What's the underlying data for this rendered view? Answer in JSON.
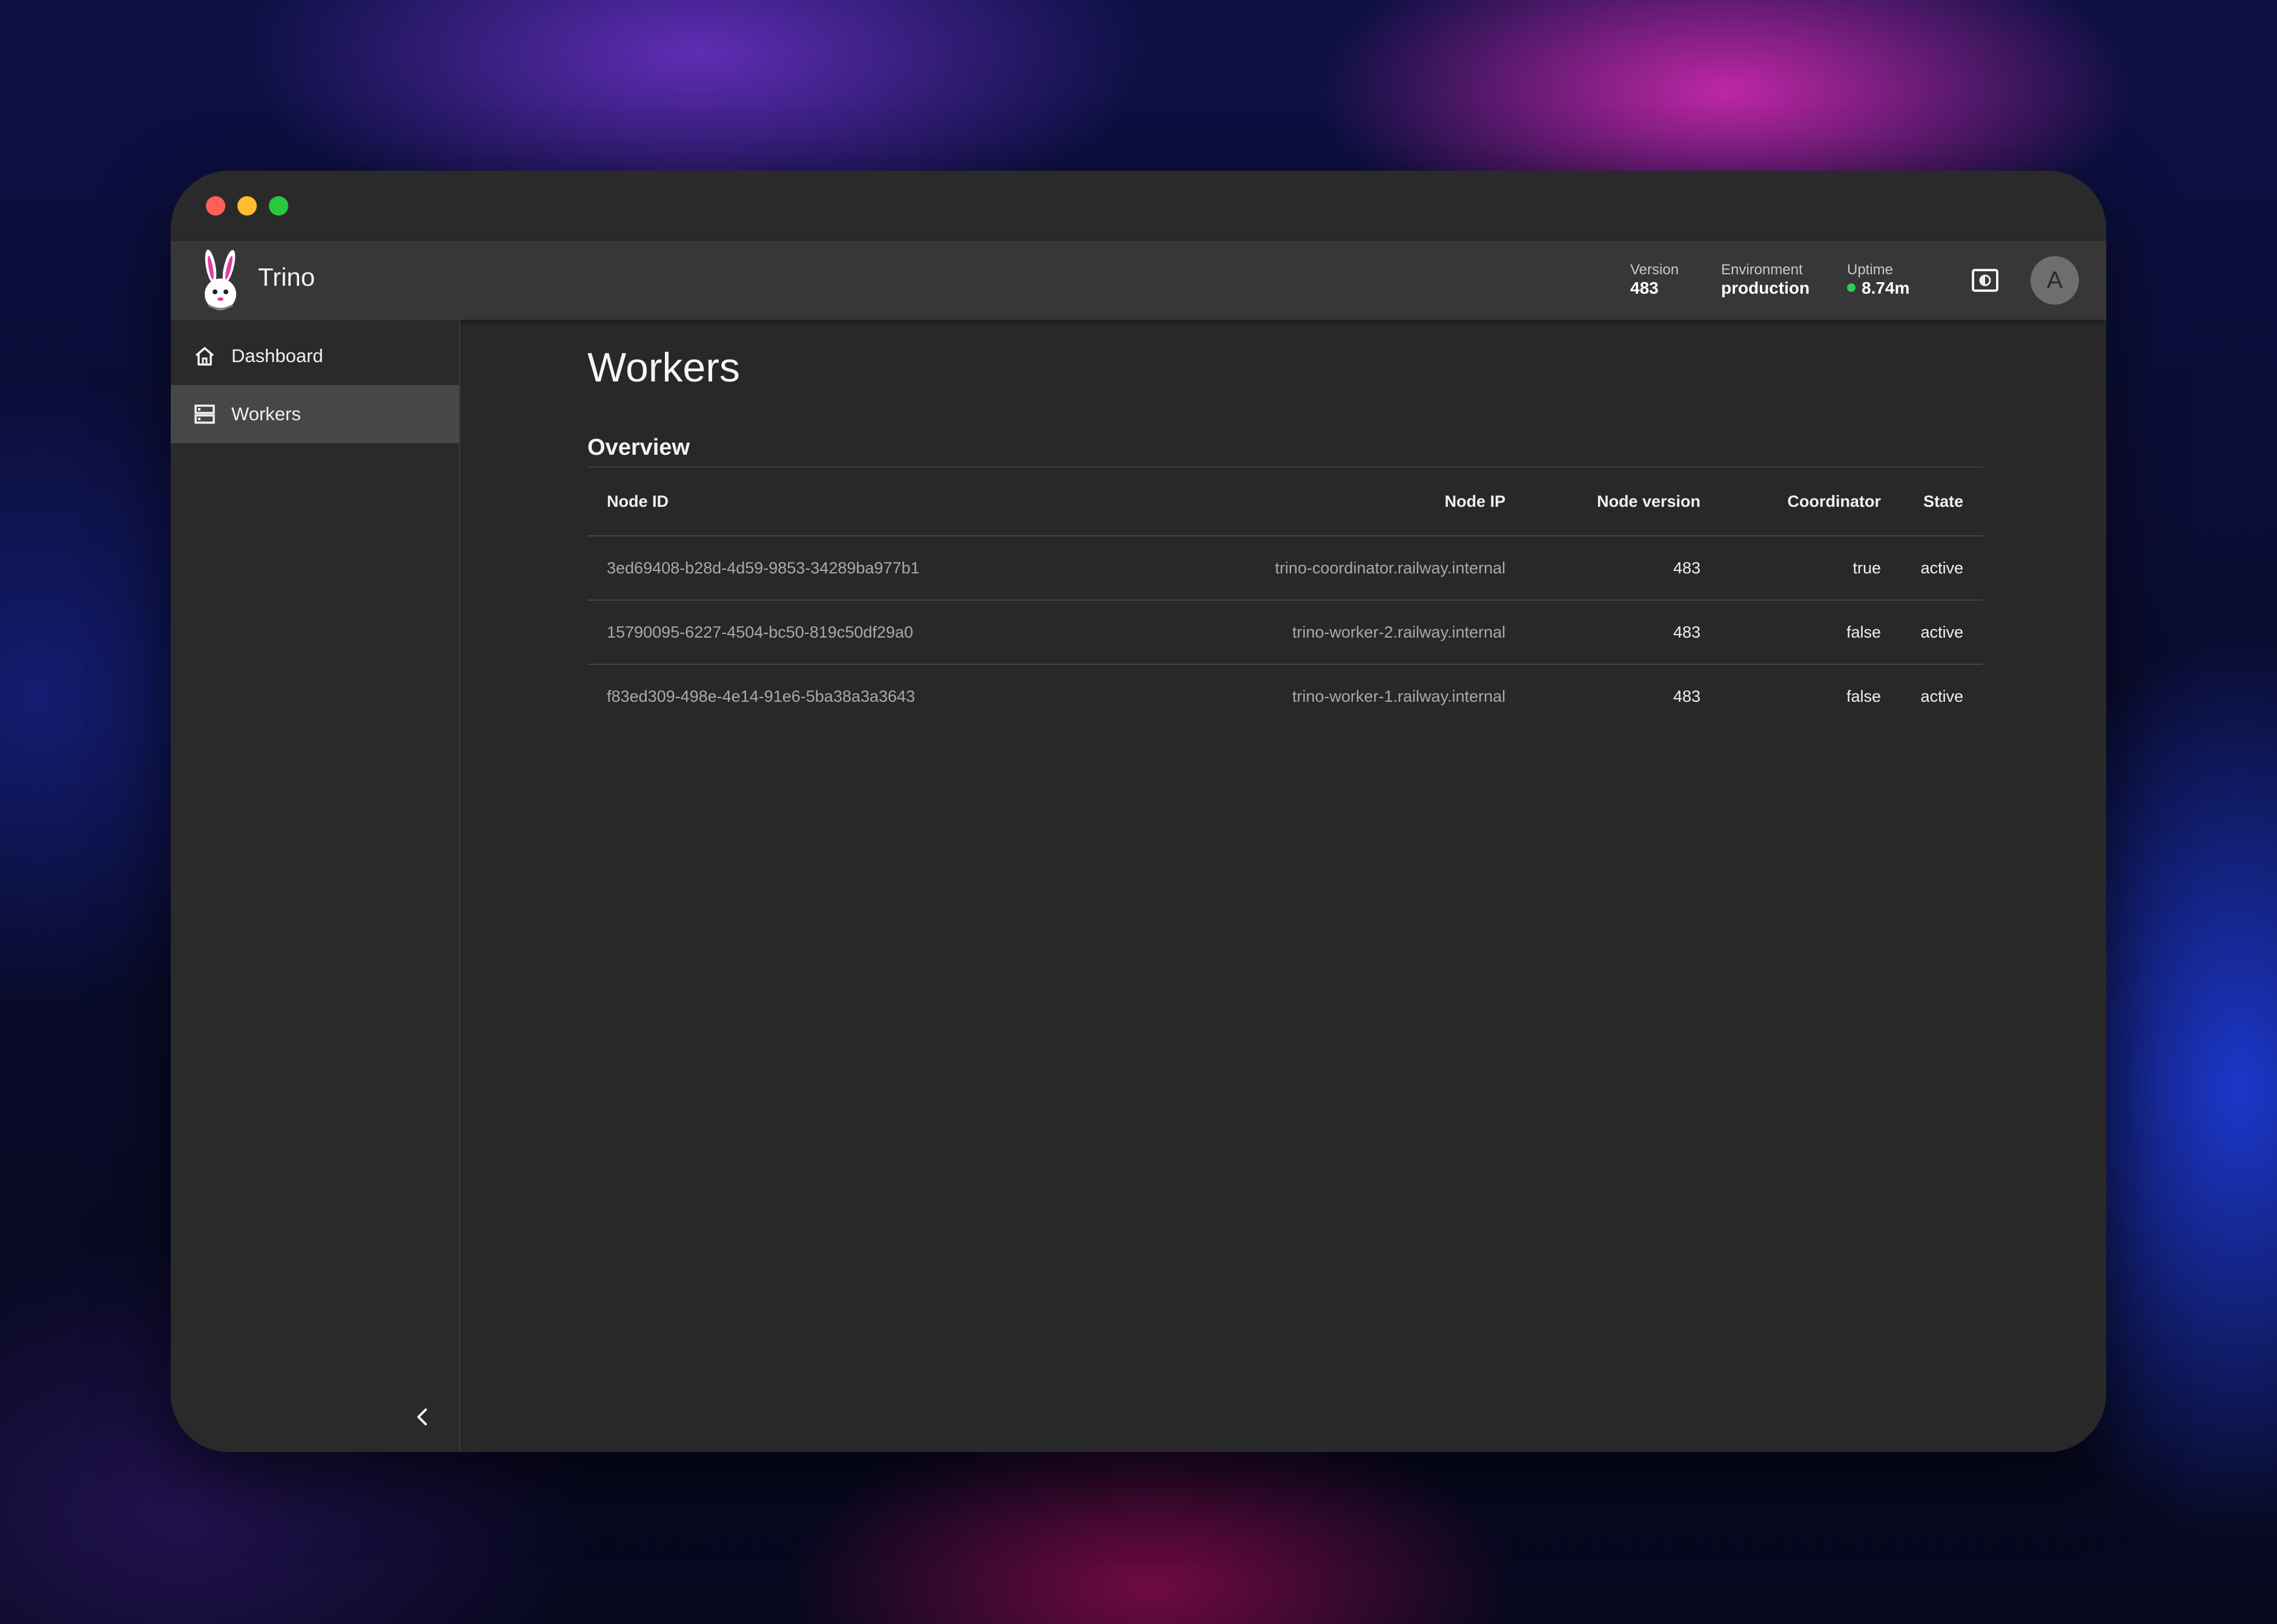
{
  "window": {
    "controls": [
      "close",
      "minimize",
      "maximize"
    ]
  },
  "header": {
    "brand": "Trino",
    "version": {
      "label": "Version",
      "value": "483"
    },
    "environment": {
      "label": "Environment",
      "value": "production"
    },
    "uptime": {
      "label": "Uptime",
      "value": "8.74m",
      "status_color": "#2ecc55"
    },
    "theme_toggle_icon": "contrast-icon",
    "avatar_initial": "A"
  },
  "sidebar": {
    "items": [
      {
        "label": "Dashboard",
        "icon": "home-icon",
        "active": false
      },
      {
        "label": "Workers",
        "icon": "server-icon",
        "active": true
      }
    ],
    "collapse_icon": "chevron-left-icon"
  },
  "main": {
    "title": "Workers",
    "section": "Overview",
    "table": {
      "headers": [
        "Node ID",
        "Node IP",
        "Node version",
        "Coordinator",
        "State"
      ],
      "rows": [
        [
          "3ed69408-b28d-4d59-9853-34289ba977b1",
          "trino-coordinator.railway.internal",
          "483",
          "true",
          "active"
        ],
        [
          "15790095-6227-4504-bc50-819c50df29a0",
          "trino-worker-2.railway.internal",
          "483",
          "false",
          "active"
        ],
        [
          "f83ed309-498e-4e14-91e6-5ba38a3a3643",
          "trino-worker-1.railway.internal",
          "483",
          "false",
          "active"
        ]
      ]
    }
  }
}
